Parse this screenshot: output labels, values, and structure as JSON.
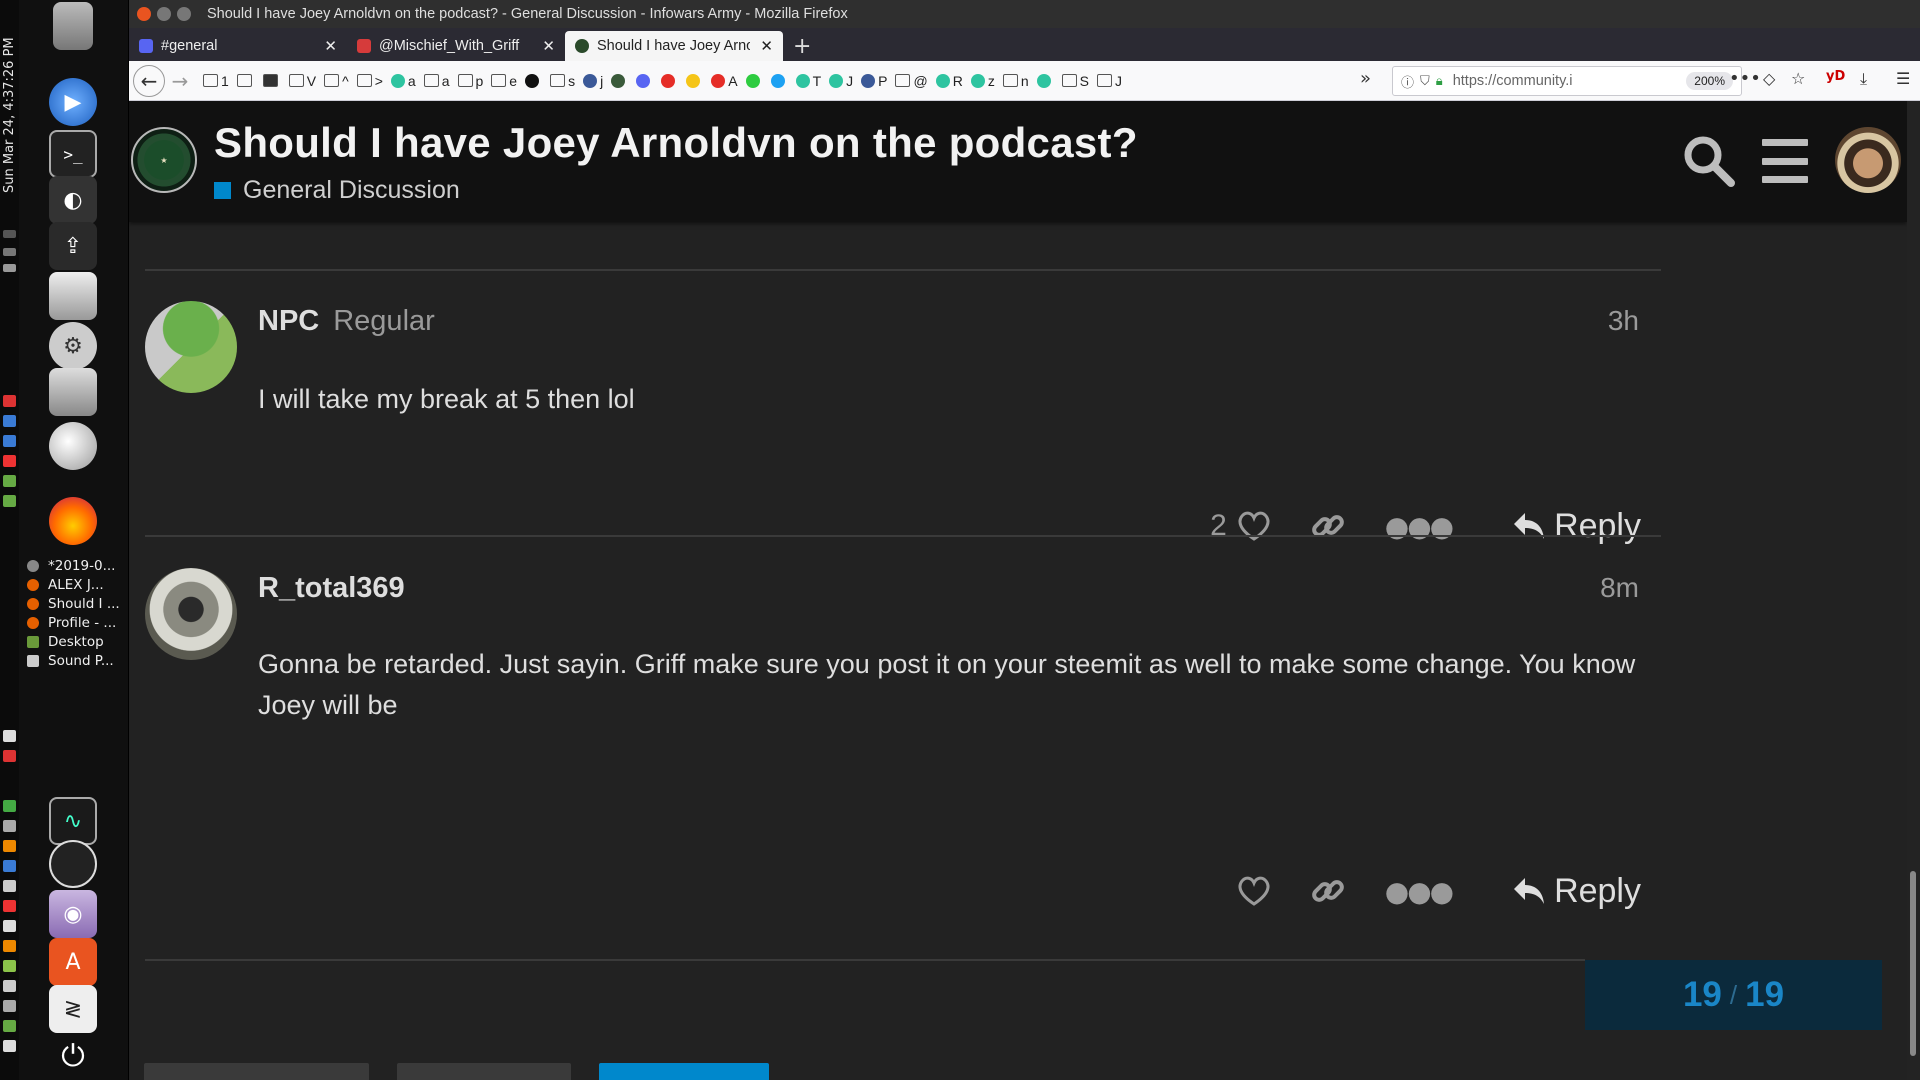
{
  "os": {
    "clock": "Sun Mar 24,  4:37:26 PM",
    "window_list": [
      {
        "label": "*2019-0...",
        "color": "#888888"
      },
      {
        "label": "ALEX J...",
        "color": "#e66000"
      },
      {
        "label": "Should I ...",
        "color": "#e66000"
      },
      {
        "label": "Profile - ...",
        "color": "#e66000"
      },
      {
        "label": "Desktop",
        "color": "#6a9a3a"
      },
      {
        "label": "Sound P...",
        "color": "#cccccc"
      }
    ]
  },
  "browser": {
    "window_title": "Should I have Joey Arnoldvn on the podcast? - General Discussion - Infowars Army - Mozilla Firefox",
    "tabs": [
      {
        "label": "#general",
        "active": false
      },
      {
        "label": "@Mischief_With_Griff",
        "active": false
      },
      {
        "label": "Should I have Joey Arno",
        "active": true
      }
    ],
    "new_tab": "+",
    "bookmarks": [
      {
        "label": "1",
        "kind": "folder"
      },
      {
        "label": "",
        "kind": "folder"
      },
      {
        "label": "",
        "kind": "car"
      },
      {
        "label": "V",
        "kind": "folder"
      },
      {
        "label": "^",
        "kind": "folder"
      },
      {
        "label": ">",
        "kind": "folder"
      },
      {
        "label": "a",
        "kind": "circle",
        "color": "#2ec4a0"
      },
      {
        "label": "a",
        "kind": "folder"
      },
      {
        "label": "p",
        "kind": "folder"
      },
      {
        "label": "e",
        "kind": "folder"
      },
      {
        "label": "",
        "kind": "circle",
        "color": "#111111"
      },
      {
        "label": "s",
        "kind": "folder"
      },
      {
        "label": "j",
        "kind": "circle",
        "color": "#3b5998"
      },
      {
        "label": "",
        "kind": "circle",
        "color": "#3a5a3a"
      },
      {
        "label": "",
        "kind": "circle",
        "color": "#5865f2"
      },
      {
        "label": "",
        "kind": "circle",
        "color": "#e52d27"
      },
      {
        "label": "",
        "kind": "circle",
        "color": "#f5c518"
      },
      {
        "label": "A",
        "kind": "circle",
        "color": "#e52d27"
      },
      {
        "label": "",
        "kind": "circle",
        "color": "#2ecc40"
      },
      {
        "label": "",
        "kind": "circle",
        "color": "#1da1f2"
      },
      {
        "label": "T",
        "kind": "circle",
        "color": "#2ec4a0"
      },
      {
        "label": "J",
        "kind": "circle",
        "color": "#2ec4a0"
      },
      {
        "label": "P",
        "kind": "circle",
        "color": "#3b5998"
      },
      {
        "label": "@",
        "kind": "folder"
      },
      {
        "label": "R",
        "kind": "circle",
        "color": "#2ec4a0"
      },
      {
        "label": "z",
        "kind": "circle",
        "color": "#2ec4a0"
      },
      {
        "label": "n",
        "kind": "folder"
      },
      {
        "label": "",
        "kind": "circle",
        "color": "#2ec4a0"
      },
      {
        "label": "S",
        "kind": "folder"
      },
      {
        "label": "J",
        "kind": "folder"
      }
    ],
    "overflow": "»",
    "url": "https://community.i",
    "zoom": "200%"
  },
  "header": {
    "title": "Should I have Joey Arnoldvn on the podcast?",
    "category": "General Discussion",
    "category_color": "#0088cc"
  },
  "posts": [
    {
      "username": "NPC",
      "user_title": "Regular",
      "time": "3h",
      "body": "I will take my break at 5 then lol",
      "likes": "2",
      "reply_label": "Reply"
    },
    {
      "username": "R_total369",
      "user_title": "",
      "time": "8m",
      "body": "Gonna be retarded. Just sayin. Griff make sure you post it on your steemit as well to make some change. You know Joey will be",
      "likes": "",
      "reply_label": "Reply"
    }
  ],
  "progress": {
    "current": "19",
    "separator": "/",
    "total": "19"
  }
}
